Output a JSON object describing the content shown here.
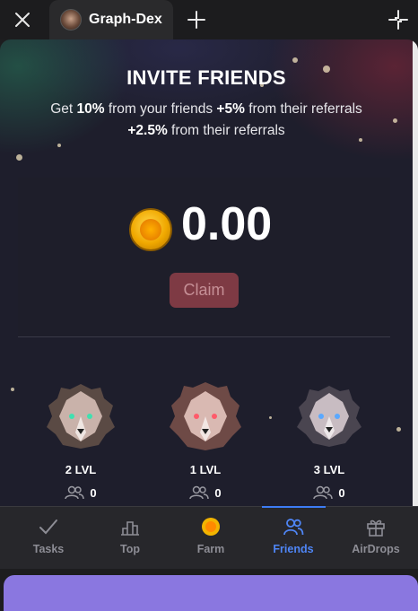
{
  "topbar": {
    "tab_title": "Graph-Dex",
    "icons": [
      "close-icon",
      "plus-icon",
      "collapse-icon"
    ]
  },
  "invite": {
    "title": "INVITE FRIENDS",
    "line1_prefix": "Get ",
    "line1_pct1": "10%",
    "line1_mid": " from your friends ",
    "line1_pct2": "+5%",
    "line1_suffix": " from their referrals",
    "line2_pct": "+2.5%",
    "line2_suffix": " from their referrals"
  },
  "balance": {
    "value": "0.00",
    "claim_label": "Claim"
  },
  "levels": [
    {
      "label": "2 LVL",
      "count": "0",
      "eye_color": "#3fe0b0"
    },
    {
      "label": "1 LVL",
      "count": "0",
      "eye_color": "#ff5a6a"
    },
    {
      "label": "3 LVL",
      "count": "0",
      "eye_color": "#5aa8ff"
    }
  ],
  "nav": {
    "items": [
      {
        "label": "Tasks",
        "icon": "check-icon"
      },
      {
        "label": "Top",
        "icon": "podium-icon"
      },
      {
        "label": "Farm",
        "icon": "coin-icon"
      },
      {
        "label": "Friends",
        "icon": "friends-icon",
        "active": true
      },
      {
        "label": "AirDrops",
        "icon": "gift-icon"
      }
    ]
  },
  "colors": {
    "accent": "#4f86f7",
    "claim": "#7e3a44",
    "cta": "#8a77e0"
  }
}
